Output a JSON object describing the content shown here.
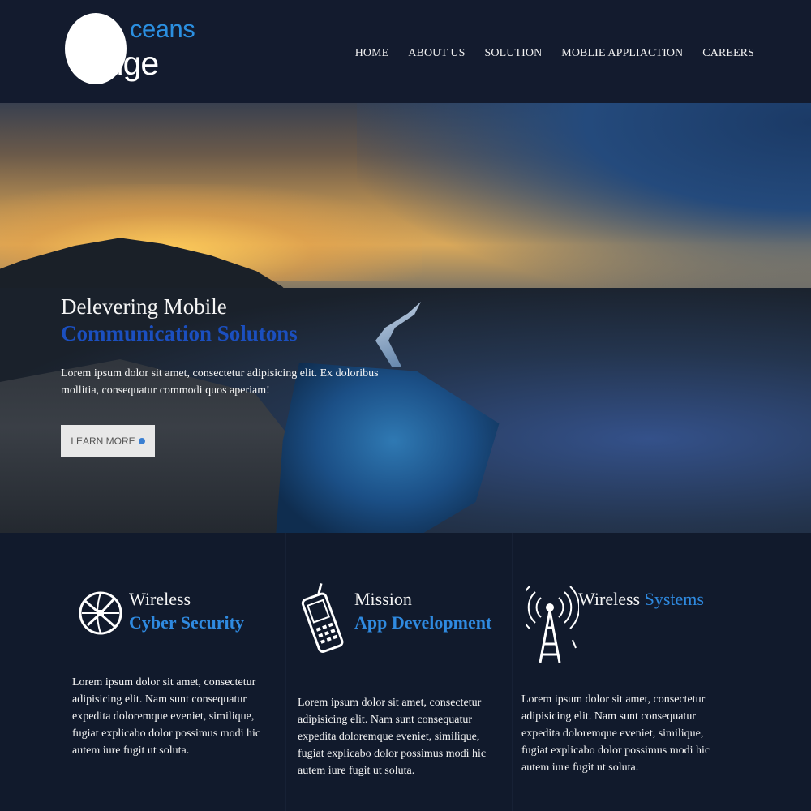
{
  "logo": {
    "word1": "ceans",
    "word2": "edge"
  },
  "nav": [
    {
      "label": "HOME"
    },
    {
      "label": "ABOUT US"
    },
    {
      "label": "SOLUTION"
    },
    {
      "label": "MOBLIE APPLIACTION"
    },
    {
      "label": "CAREERS"
    }
  ],
  "hero": {
    "line1": "Delevering Mobile",
    "line2": "Communication Solutons",
    "body": "Lorem ipsum dolor sit amet, consectetur adipisicing elit. Ex doloribus mollitia, consequatur commodi quos aperiam!",
    "button": "LEARN MORE"
  },
  "features": [
    {
      "icon": "globe-satellite-icon",
      "title1": "Wireless",
      "title2": "Cyber Security",
      "text": "Lorem ipsum dolor sit amet, consectetur adipisicing elit. Nam sunt consequatur expedita doloremque eveniet, similique, fugiat explicabo dolor possimus modi hic autem iure fugit ut soluta."
    },
    {
      "icon": "mobile-phone-icon",
      "title1": "Mission",
      "title2": "App Development",
      "text": "Lorem ipsum dolor sit amet, consectetur adipisicing elit. Nam sunt consequatur expedita doloremque eveniet, similique, fugiat explicabo dolor possimus modi hic autem iure fugit ut soluta."
    },
    {
      "icon": "radio-tower-icon",
      "title1": "Wireless",
      "title2": "Systems",
      "text": "Lorem ipsum dolor sit amet, consectetur adipisicing elit. Nam sunt consequatur expedita doloremque eveniet, similique, fugiat explicabo dolor possimus modi hic autem iure fugit ut soluta."
    }
  ],
  "colors": {
    "header_bg": "#131b2e",
    "accent_blue": "#2f8ae0",
    "hero_title_blue": "#1b4fbf"
  }
}
